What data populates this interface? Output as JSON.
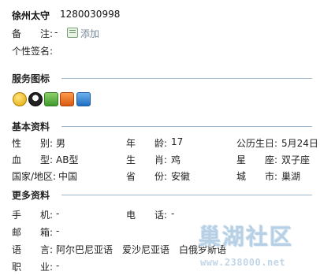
{
  "profile": {
    "nickname": "徐州太守",
    "qq": "1280030998",
    "remark_label": "备　　注:",
    "remark_value": "-",
    "add_label": "添加",
    "signature_label": "个性签名:"
  },
  "sections": {
    "services": "服务图标",
    "basic": "基本资料",
    "more": "更多资料"
  },
  "services_icons": [
    "qq-face-icon",
    "penguin-icon",
    "pet-icon",
    "home-icon",
    "photo-icon"
  ],
  "basic": {
    "gender_label": "性　　别:",
    "gender": "男",
    "age_label": "年　　龄:",
    "age": "17",
    "birthday_label": "公历生日:",
    "birthday": "5月24日",
    "blood_label": "血　　型:",
    "blood": "AB型",
    "zodiac_label": "生　　肖:",
    "zodiac": "鸡",
    "constellation_label": "星　　座:",
    "constellation": "双子座",
    "country_label": "国家/地区:",
    "country": "中国",
    "province_label": "省　　份:",
    "province": "安徽",
    "city_label": "城　　市:",
    "city": "巢湖"
  },
  "more": {
    "mobile_label": "手　　机:",
    "mobile": "-",
    "phone_label": "电　　话:",
    "phone": "-",
    "email_label": "邮　　箱:",
    "email": "-",
    "language_label": "语　　言:",
    "languages": "阿尔巴尼亚语　爱沙尼亚语　白俄罗斯语",
    "job_label": "职　　业:",
    "job": "-"
  },
  "watermark": {
    "brand": "巢湖社区",
    "url": "www.238000.net"
  }
}
